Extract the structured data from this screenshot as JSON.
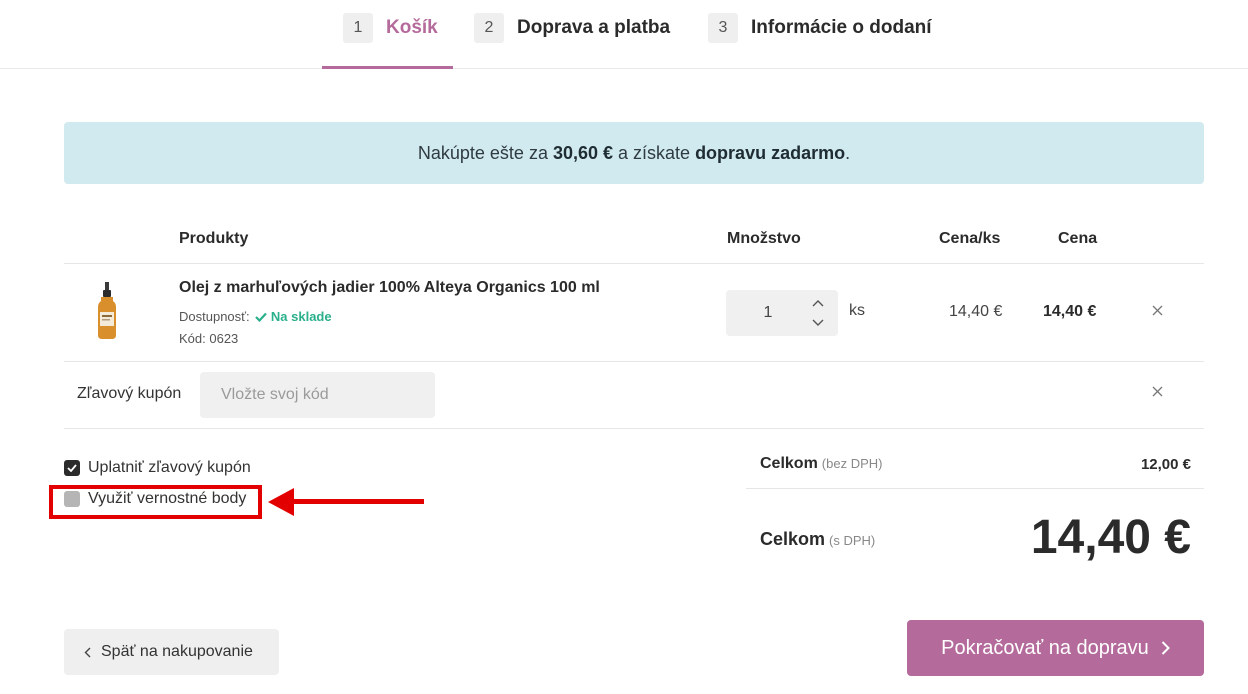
{
  "steps": [
    {
      "num": "1",
      "label": "Košík"
    },
    {
      "num": "2",
      "label": "Doprava a platba"
    },
    {
      "num": "3",
      "label": "Informácie o dodaní"
    }
  ],
  "banner": {
    "prefix": "Nakúpte ešte za",
    "amount": "30,60 €",
    "middle": "a získate",
    "highlight": "dopravu zadarmo",
    "suffix": "."
  },
  "table": {
    "headers": {
      "products": "Produkty",
      "quantity": "Množstvo",
      "unit_price": "Cena/ks",
      "price": "Cena"
    }
  },
  "cart_item": {
    "name": "Olej z marhuľových jadier 100% Alteya Organics 100 ml",
    "availability_label": "Dostupnosť:",
    "availability_value": "Na sklade",
    "code": "Kód: 0623",
    "quantity": "1",
    "quantity_unit": "ks",
    "unit_price": "14,40 €",
    "line_price": "14,40 €"
  },
  "coupon": {
    "label": "Zľavový kupón",
    "placeholder": "Vložte svoj kód"
  },
  "options": [
    {
      "label": "Uplatniť zľavový kupón",
      "checked": true
    },
    {
      "label": "Využiť vernostné body",
      "checked": false
    }
  ],
  "totals": {
    "without_vat_label": "Celkom",
    "without_vat_note": "(bez DPH)",
    "without_vat_value": "12,00 €",
    "with_vat_label": "Celkom",
    "with_vat_note": "(s DPH)",
    "with_vat_value": "14,40 €"
  },
  "buttons": {
    "back": "Späť na nakupovanie",
    "next": "Pokračovať na dopravu"
  },
  "colors": {
    "accent": "#b46b9c",
    "banner_bg": "#d1eaef",
    "in_stock": "#2bb08c",
    "annotation": "#e30000"
  }
}
